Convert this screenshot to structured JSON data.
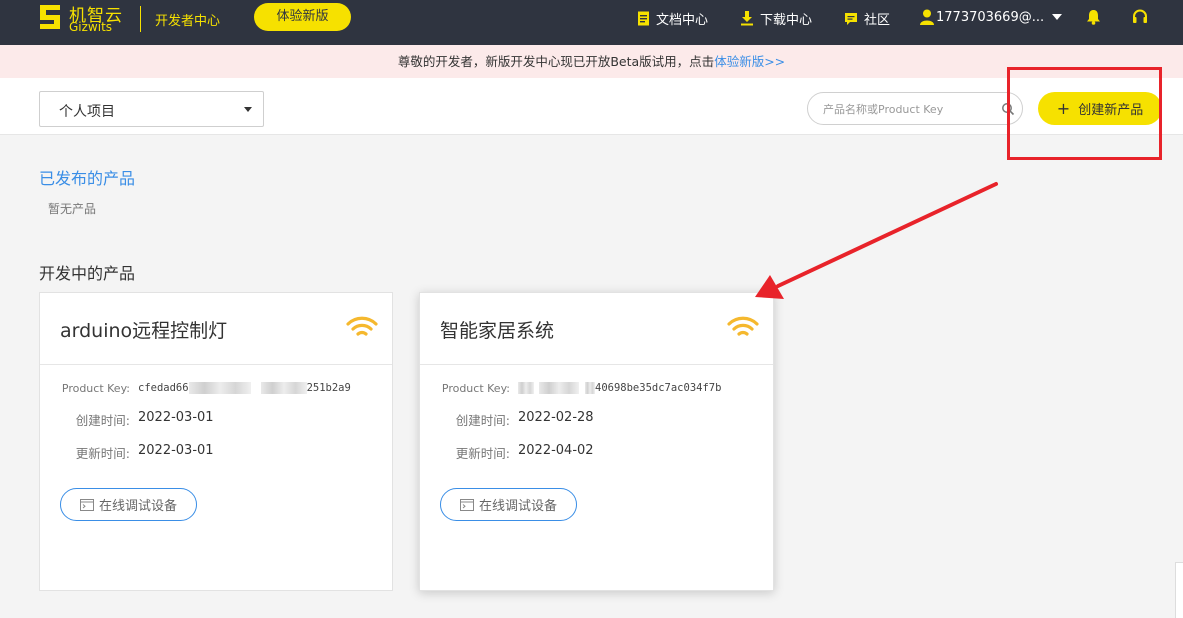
{
  "header": {
    "logo_cn": "机智云",
    "logo_en": "Gizwits",
    "dev_center": "开发者中心",
    "try_new": "体验新版",
    "nav": {
      "docs": "文档中心",
      "download": "下载中心",
      "community": "社区",
      "user": "1773703669@..."
    }
  },
  "banner": {
    "text": "尊敬的开发者，新版开发中心现已开放Beta版试用，点击",
    "link": "体验新版>>"
  },
  "toolbar": {
    "project_select": "个人项目",
    "search_placeholder": "产品名称或Product Key",
    "create_button": "创建新产品"
  },
  "sections": {
    "published_title": "已发布的产品",
    "published_empty": "暂无产品",
    "developing_title": "开发中的产品"
  },
  "labels": {
    "product_key": "Product Key:",
    "created": "创建时间:",
    "updated": "更新时间:",
    "debug": "在线调试设备"
  },
  "products": [
    {
      "name": "arduino远程控制灯",
      "key_prefix": "cfedad66",
      "key_suffix": "251b2a9",
      "created": "2022-03-01",
      "updated": "2022-03-01"
    },
    {
      "name": "智能家居系统",
      "key_prefix": "",
      "key_suffix": "40698be35dc7ac034f7b",
      "created": "2022-02-28",
      "updated": "2022-04-02"
    }
  ],
  "colors": {
    "topbar": "#2f3440",
    "accent_yellow": "#f6e100",
    "link_blue": "#3a8ee6",
    "banner_bg": "#fceaea",
    "annotation_red": "#e8232a",
    "wifi_orange": "#f5b82e"
  },
  "icons": [
    "logo-icon",
    "document-icon",
    "download-icon",
    "chat-icon",
    "user-icon",
    "caret-down-icon",
    "bell-icon",
    "headset-icon",
    "search-icon",
    "plus-icon",
    "wifi-icon",
    "terminal-icon"
  ]
}
